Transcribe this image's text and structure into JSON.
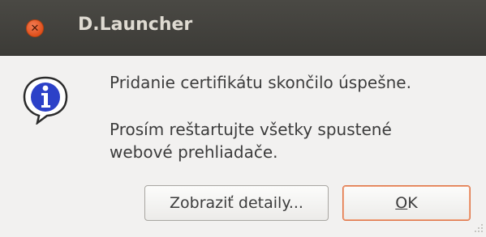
{
  "window": {
    "title": "D.Launcher",
    "close_icon": "close-icon"
  },
  "dialog": {
    "icon": "info-icon",
    "message_primary": "Pridanie certifikátu skončilo úspešne.",
    "message_secondary": "Prosím reštartujte všetky spustené webové prehliadače."
  },
  "buttons": {
    "details_label": "Zobraziť detaily...",
    "ok_mnemonic": "O",
    "ok_rest": "K"
  },
  "colors": {
    "titlebar": "#3c3b37",
    "close_button": "#e0501c",
    "ok_focus_border": "#e07446",
    "background": "#f2f1f0"
  }
}
